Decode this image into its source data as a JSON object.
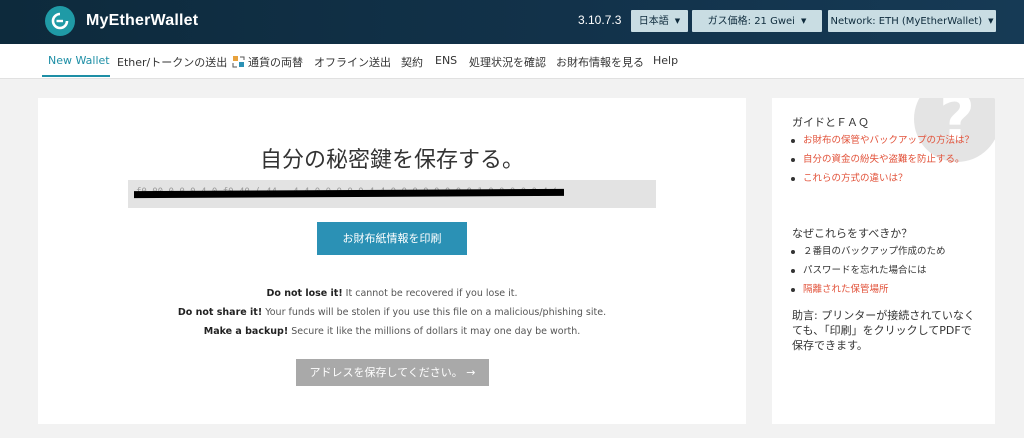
{
  "header": {
    "brand": "MyEtherWallet",
    "version": "3.10.7.3",
    "language": "日本語",
    "gas_price": "ガス価格: 21 Gwei",
    "network": "Network: ETH (MyEtherWallet)"
  },
  "nav": {
    "items": [
      {
        "label": "New Wallet",
        "active": true
      },
      {
        "label": "Ether/トークンの送出"
      },
      {
        "label": "通貨の両替"
      },
      {
        "label": "オフライン送出"
      },
      {
        "label": "契約"
      },
      {
        "label": "ENS"
      },
      {
        "label": "処理状況を確認"
      },
      {
        "label": "お財布情報を見る"
      },
      {
        "label": "Help"
      }
    ]
  },
  "main": {
    "title": "自分の秘密鍵を保存する。",
    "private_key_hint": "f0  00  0  0  0  4  0  f0  40  ( 44  -  4  4 0 0  0 0 0  4  4  0 0  0  0 0  0 0 0 1  0 0  0 0 0  4 0",
    "print_button": "お財布紙情報を印刷",
    "warnings": [
      {
        "bold": "Do not lose it!",
        "text": " It cannot be recovered if you lose it."
      },
      {
        "bold": "Do not share it!",
        "text": " Your funds will be stolen if you use this file on a malicious/phishing site."
      },
      {
        "bold": "Make a backup!",
        "text": " Secure it like the millions of dollars it may one day be worth."
      }
    ],
    "save_button": "アドレスを保存してください。 →"
  },
  "sidebar": {
    "faq_heading": "ガイドとＦＡＱ",
    "faq_links": [
      "お財布の保管やバックアップの方法は？",
      "自分の資金の紛失や盗難を防止する。",
      "これらの方式の違いは？"
    ],
    "why_heading": "なぜこれらをすべきか？",
    "why_items": [
      {
        "label": "２番目のバックアップ作成のため",
        "link": false
      },
      {
        "label": "パスワードを忘れた場合には",
        "link": false
      },
      {
        "label": "隔離された保管場所",
        "link": true
      }
    ],
    "tip": "助言: プリンターが接続されていなくても、「印刷」をクリックしてPDFで保存できます。"
  },
  "colors": {
    "header_bg": "#12324a",
    "accent_teal": "#1e8fa6",
    "primary_button": "#2b91b5",
    "link_red": "#e2523a"
  }
}
